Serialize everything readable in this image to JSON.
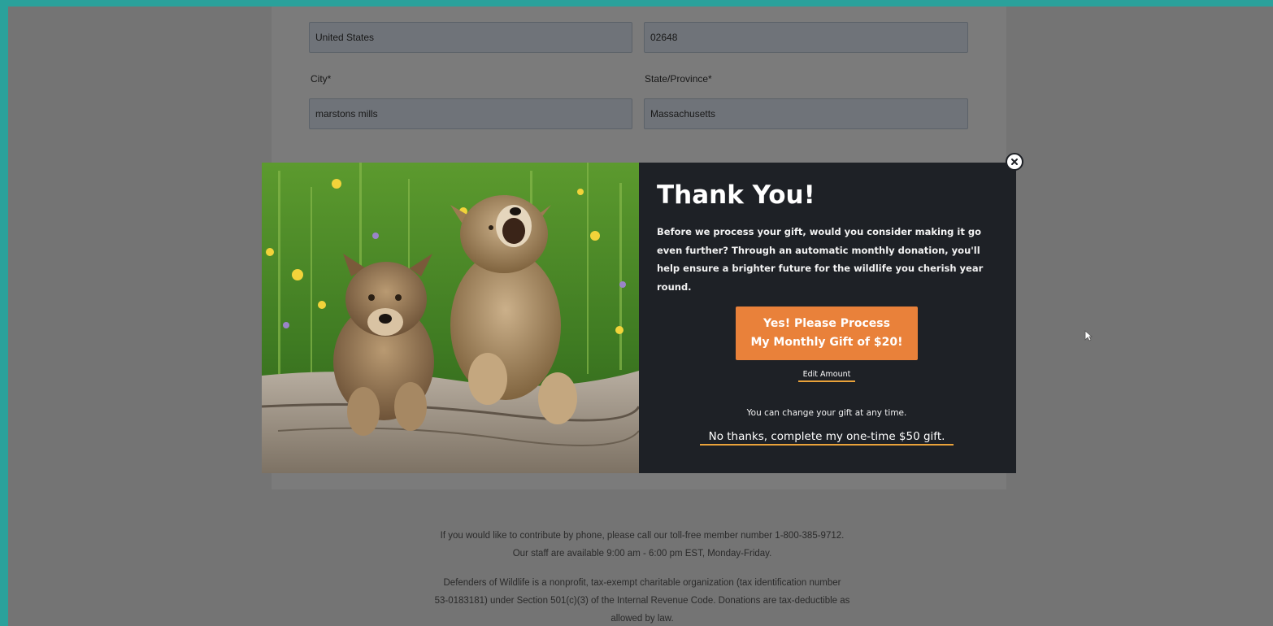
{
  "form": {
    "country_value": "United States",
    "zip_value": "02648",
    "city_label": "City*",
    "city_value": "marstons mills",
    "state_label": "State/Province*",
    "state_value": "Massachusetts"
  },
  "footer": {
    "phone_line1": "If you would like to contribute by phone, please call our toll-free member number 1-800-385-9712.",
    "phone_line2": "Our staff are available 9:00 am - 6:00 pm EST, Monday-Friday.",
    "tax_line1": "Defenders of Wildlife is a nonprofit, tax-exempt charitable organization (tax identification number",
    "tax_line2": "53-0183181) under Section 501(c)(3) of the Internal Revenue Code. Donations are tax-deductible as",
    "tax_line3": "allowed by law."
  },
  "modal": {
    "title": "Thank You!",
    "body": "Before we process your gift, would you consider making it go even further? Through an automatic monthly donation, you'll help ensure a brighter future for the wildlife you cherish year round.",
    "yes_button_line1": "Yes! Please Process",
    "yes_button_line2": "My Monthly Gift of $20!",
    "edit_amount": "Edit Amount",
    "change_note": "You can change your gift at any time.",
    "no_thanks": "No thanks, complete my one-time $50 gift.",
    "image": "wolf-pups-photo",
    "close_icon": "close-circle-icon"
  },
  "colors": {
    "modal_bg": "#1e2126",
    "accent_orange": "#e9813a",
    "underline": "#e9a23a",
    "page_frame": "#2aa19b"
  }
}
